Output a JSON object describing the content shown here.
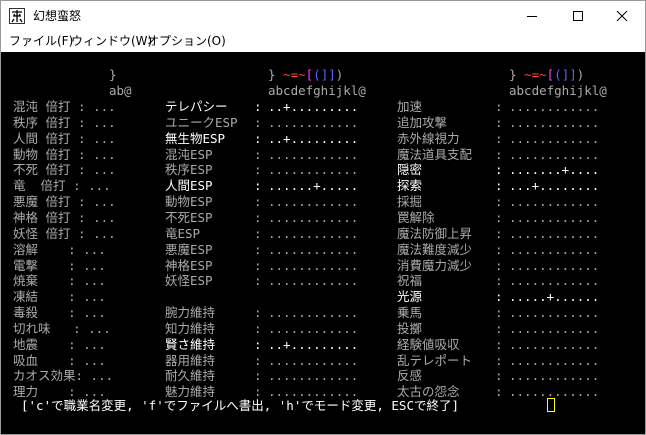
{
  "window": {
    "title": "幻想蛮怒",
    "icon": "app-kanji-icon"
  },
  "menu": [
    "ファイル(F)",
    "ウィンドウ(W)",
    "オプション(O)"
  ],
  "header": {
    "left_a": "}",
    "left_b": "ab@",
    "mid_a1": "}",
    "mid_a2": "~=~",
    "mid_a3": "[",
    "mid_a4": "(]]",
    "mid_a5": ")",
    "mid_b": "abcdefghijkl@",
    "right_a1": "}",
    "right_a2": "~=~",
    "right_a3": "[",
    "right_a4": "(]]",
    "right_a5": ")",
    "right_b": "abcdefghijkl@"
  },
  "col1": [
    "混沌 倍打 : ...",
    "秩序 倍打 : ...",
    "人間 倍打 : ...",
    "動物 倍打 : ...",
    "不死 倍打 : ...",
    "竜  倍打 : ...",
    "悪魔 倍打 : ...",
    "神格 倍打 : ...",
    "妖怪 倍打 : ...",
    "溶解    : ...",
    "電撃    : ...",
    "焼棄    : ...",
    "凍結    : ...",
    "毒殺    : ...",
    "切れ味   : ...",
    "地震    : ...",
    "吸血    : ...",
    "カオス効果: ...",
    "理力    : ..."
  ],
  "col2": [
    {
      "label": "テレパシー",
      "dots": "..+.........",
      "hl": true
    },
    {
      "label": "ユニークESP",
      "dots": "............",
      "hl": false
    },
    {
      "label": "無生物ESP",
      "dots": "..+.........",
      "hl": true
    },
    {
      "label": "混沌ESP",
      "dots": "............",
      "hl": false
    },
    {
      "label": "秩序ESP",
      "dots": "............",
      "hl": false
    },
    {
      "label": "人間ESP",
      "dots": "......+.....",
      "hl": true
    },
    {
      "label": "動物ESP",
      "dots": "............",
      "hl": false
    },
    {
      "label": "不死ESP",
      "dots": "............",
      "hl": false
    },
    {
      "label": "竜ESP",
      "dots": "............",
      "hl": false
    },
    {
      "label": "悪魔ESP",
      "dots": "............",
      "hl": false
    },
    {
      "label": "神格ESP",
      "dots": "............",
      "hl": false
    },
    {
      "label": "妖怪ESP",
      "dots": "............",
      "hl": false
    },
    {
      "label": "",
      "dots": "",
      "hl": false
    },
    {
      "label": "腕力維持",
      "dots": "............",
      "hl": false
    },
    {
      "label": "知力維持",
      "dots": "............",
      "hl": false
    },
    {
      "label": "賢さ維持",
      "dots": "..+.........",
      "hl": true
    },
    {
      "label": "器用維持",
      "dots": "............",
      "hl": false
    },
    {
      "label": "耐久維持",
      "dots": "............",
      "hl": false
    },
    {
      "label": "魅力維持",
      "dots": "............",
      "hl": false
    }
  ],
  "col3": [
    {
      "label": "加速",
      "dots": "............",
      "hl": false
    },
    {
      "label": "追加攻撃",
      "dots": "............",
      "hl": false
    },
    {
      "label": "赤外線視力",
      "dots": "............",
      "hl": false
    },
    {
      "label": "魔法道具支配",
      "dots": "............",
      "hl": false
    },
    {
      "label": "隠密",
      "dots": ".......+....",
      "hl": true
    },
    {
      "label": "探索",
      "dots": "...+........",
      "hl": true
    },
    {
      "label": "採掘",
      "dots": "............",
      "hl": false
    },
    {
      "label": "罠解除",
      "dots": "............",
      "hl": false
    },
    {
      "label": "魔法防御上昇",
      "dots": "............",
      "hl": false
    },
    {
      "label": "魔法難度減少",
      "dots": "............",
      "hl": false
    },
    {
      "label": "消費魔力減少",
      "dots": "............",
      "hl": false
    },
    {
      "label": "祝福",
      "dots": "............",
      "hl": false
    },
    {
      "label": "光源",
      "dots": ".....+......",
      "hl": true
    },
    {
      "label": "乗馬",
      "dots": "............",
      "hl": false
    },
    {
      "label": "投擲",
      "dots": "............",
      "hl": false
    },
    {
      "label": "経験値吸収",
      "dots": "............",
      "hl": false
    },
    {
      "label": "乱テレポート",
      "dots": "............",
      "hl": false
    },
    {
      "label": "反感",
      "dots": "............",
      "hl": false
    },
    {
      "label": "太古の怨念",
      "dots": "............",
      "hl": false
    }
  ],
  "prompt": "['c'で職業名変更, 'f'でファイルへ書出, 'h'でモード変更, ESCで終了]",
  "colors": {
    "terminal_bg": "#000000",
    "text_dim": "#aaaaaa",
    "text_bright": "#ffffff",
    "accent_cyan": "#00ffff",
    "accent_red": "#ff4040",
    "accent_blue": "#6060ff",
    "accent_magenta": "#ff40ff",
    "cursor": "#ffff00"
  }
}
